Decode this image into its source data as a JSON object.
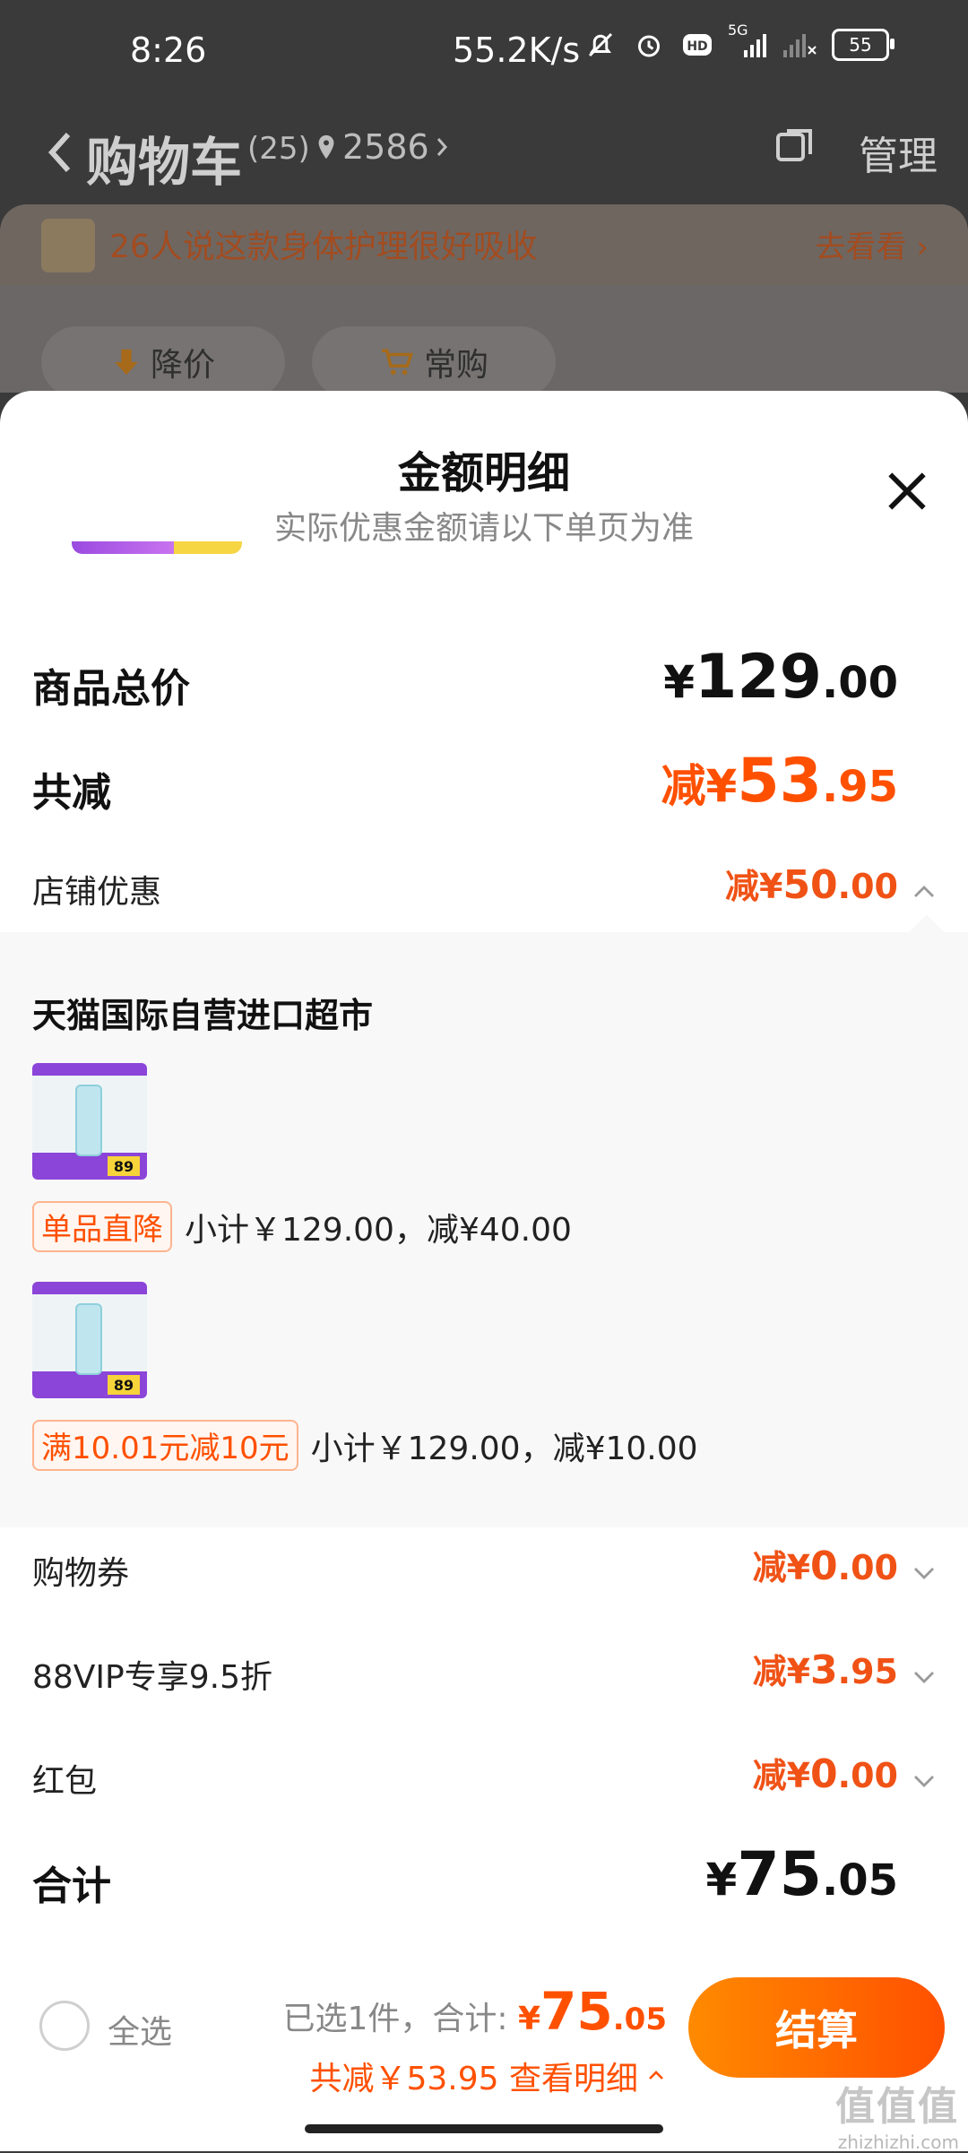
{
  "status_bar": {
    "time": "8:26",
    "net_speed": "55.2K/s",
    "network_label": "5G",
    "hd_label": "HD",
    "battery": "55"
  },
  "nav": {
    "title": "购物车",
    "count": "(25)",
    "location": "2586",
    "manage": "管理"
  },
  "banner": {
    "text": "26人说这款身体护理很好吸收",
    "link": "去看看"
  },
  "filters": [
    {
      "label": "降价",
      "icon": "price-down-icon"
    },
    {
      "label": "常购",
      "icon": "cart-icon"
    }
  ],
  "sheet": {
    "title": "金额明细",
    "subtitle": "实际优惠金额请以下单页为准",
    "total_label": "商品总价",
    "total_cur": "¥",
    "total_int": "129",
    "total_dec": ".00",
    "reduce_label": "共减",
    "reduce_prefix": "减¥",
    "reduce_int": "53",
    "reduce_dec": ".95",
    "store_label": "店铺优惠",
    "store_prefix": "减¥",
    "store_int": "50",
    "store_dec": ".00",
    "shop_name": "天猫国际自营进口超市",
    "items": [
      {
        "tag": "单品直降",
        "detail": "小计￥129.00，减¥40.00",
        "badge": "89"
      },
      {
        "tag": "满10.01元减10元",
        "detail": "小计￥129.00，减¥10.00",
        "badge": "89"
      }
    ],
    "coupon_label": "购物券",
    "coupon_prefix": "减¥",
    "coupon_int": "0",
    "coupon_dec": ".00",
    "vip_label": "88VIP专享9.5折",
    "vip_prefix": "减¥",
    "vip_int": "3",
    "vip_dec": ".95",
    "redpack_label": "红包",
    "redpack_prefix": "减¥",
    "redpack_int": "0",
    "redpack_dec": ".00",
    "final_label": "合计",
    "final_cur": "¥",
    "final_int": "75",
    "final_dec": ".05"
  },
  "footer": {
    "select_all": "全选",
    "selected_text": "已选1件，合计:",
    "sum_cur": "¥",
    "sum_int": "75",
    "sum_dec": ".05",
    "saving_text": "共减￥53.95 查看明细",
    "checkout": "结算"
  },
  "watermark": {
    "main": "值值值",
    "sub": "zhizhizhi.com"
  },
  "colors": {
    "accent": "#ff5000",
    "checkout_start": "#ff8a00",
    "checkout_end": "#ff5000"
  }
}
